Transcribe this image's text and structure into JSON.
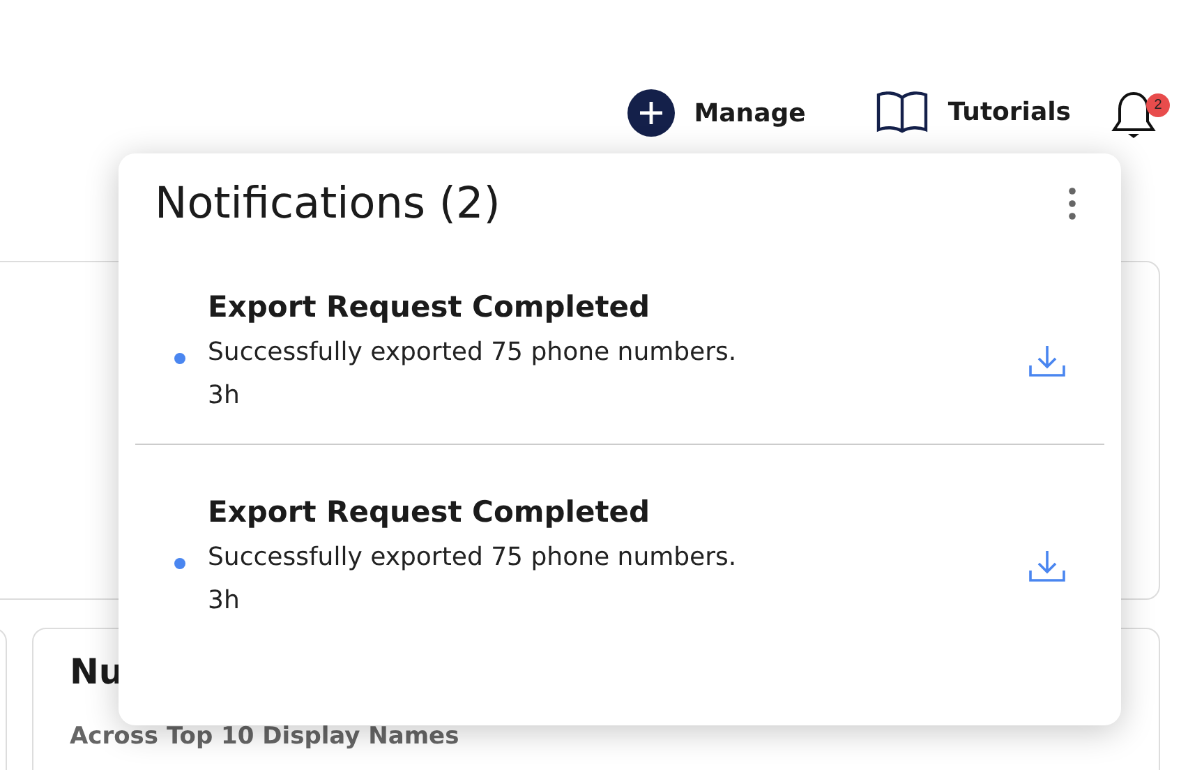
{
  "header": {
    "manage": "Manage",
    "tutorials": "Tutorials",
    "notification_count": "2"
  },
  "background_card": {
    "title": "Nu",
    "subtitle": "Across Top 10 Display Names"
  },
  "notifications_panel": {
    "title": "Notifications (2)",
    "items": [
      {
        "title": "Export Request Completed",
        "message": "Successfully exported 75 phone numbers.",
        "time": "3h",
        "unread": true
      },
      {
        "title": "Export Request Completed",
        "message": "Successfully exported 75 phone numbers.",
        "time": "3h",
        "unread": true
      }
    ]
  }
}
